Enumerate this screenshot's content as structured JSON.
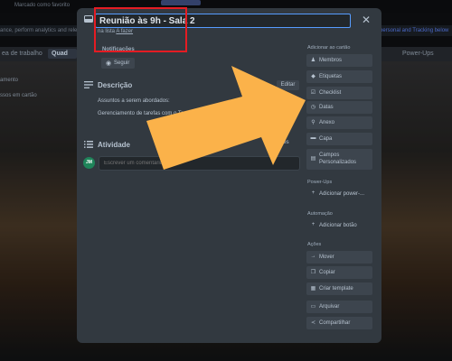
{
  "background": {
    "top_text": "Marcado como favorito",
    "bar2_text": "ance, perform analytics and rele",
    "bar2_right": "personal and Tracking below",
    "bar3_left": "ea de trabalho",
    "bar3_view": "Quad",
    "bar3_right": "Power-Ups",
    "left_items": [
      "amento",
      "ssos em cartão"
    ]
  },
  "card": {
    "title": "Reunião às 9h - Sala 2",
    "list_prefix": "na lista",
    "list_name": "A fazer",
    "close_symbol": "✕",
    "notifications_label": "Notificações",
    "follow_label": "Seguir"
  },
  "description": {
    "title": "Descrição",
    "edit_label": "Editar",
    "lines": [
      "Assuntos a serem abordados:",
      "Gerenciamento de tarefas com o Tr"
    ]
  },
  "activity": {
    "title": "Atividade",
    "hide_label": "nes",
    "avatar_initials": "JM",
    "comment_placeholder": "Escrever um comentário..."
  },
  "sidebar": {
    "add_heading": "Adicionar ao cartão",
    "add_items": [
      {
        "label": "Membros",
        "icon": "person-icon"
      },
      {
        "label": "Etiquetas",
        "icon": "tag-icon"
      },
      {
        "label": "Checklist",
        "icon": "checklist-icon"
      },
      {
        "label": "Datas",
        "icon": "clock-icon"
      },
      {
        "label": "Anexo",
        "icon": "paperclip-icon"
      },
      {
        "label": "Capa",
        "icon": "cover-icon"
      },
      {
        "label": "Campos Personalizados",
        "icon": "custom-fields-icon"
      }
    ],
    "powerups_heading": "Power-Ups",
    "powerups_button": "Adicionar power-...",
    "automation_heading": "Automação",
    "automation_button": "Adicionar botão",
    "actions_heading": "Ações",
    "action_items": [
      {
        "label": "Mover",
        "icon": "arrow-right-icon"
      },
      {
        "label": "Copiar",
        "icon": "copy-icon"
      },
      {
        "label": "Criar template",
        "icon": "template-icon"
      },
      {
        "label": "Arquivar",
        "icon": "archive-icon"
      },
      {
        "label": "Compartilhar",
        "icon": "share-icon"
      }
    ]
  },
  "colors": {
    "modal_bg": "#323940",
    "accent_blue": "#579dff",
    "annotation_red": "#e51c23",
    "annotation_arrow": "#fbb24a"
  }
}
